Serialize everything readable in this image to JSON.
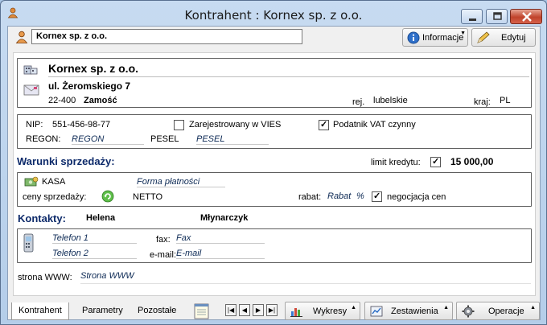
{
  "window": {
    "title": "Kontrahent : Kornex sp. z o.o."
  },
  "toolbar": {
    "name_value": "Kornex sp. z o.o.",
    "info_label": "Informacje",
    "edit_label": "Edytuj"
  },
  "address": {
    "company": "Kornex sp. z o.o.",
    "street": "ul. Żeromskiego 7",
    "postcode": "22-400",
    "city": "Zamość",
    "region_label": "rej.",
    "region": "lubelskie",
    "country_label": "kraj:",
    "country": "PL"
  },
  "ids": {
    "nip_label": "NIP:",
    "nip": "551-456-98-77",
    "vies_label": "Zarejestrowany w VIES",
    "vies_checked": false,
    "vat_label": "Podatnik VAT czynny",
    "vat_checked": true,
    "regon_label": "REGON:",
    "regon_placeholder": "REGON",
    "pesel_label": "PESEL",
    "pesel_placeholder": "PESEL"
  },
  "sales": {
    "title": "Warunki sprzedaży:",
    "credit_label": "limit kredytu:",
    "credit_checked": true,
    "credit_value": "15 000,00",
    "payment_method": "KASA",
    "payment_form_placeholder": "Forma płatności",
    "price_label": "ceny sprzedaży:",
    "price_value": "NETTO",
    "discount_label": "rabat:",
    "discount_placeholder": "Rabat",
    "discount_unit": "%",
    "negotiation_label": "negocjacja cen",
    "negotiation_checked": true
  },
  "contacts": {
    "title": "Kontakty:",
    "first_name": "Helena",
    "last_name": "Młynarczyk",
    "phone1_placeholder": "Telefon 1",
    "phone2_placeholder": "Telefon 2",
    "fax_label": "fax:",
    "fax_placeholder": "Fax",
    "email_label": "e-mail:",
    "email_placeholder": "E-mail",
    "www_label": "strona WWW:",
    "www_placeholder": "Strona WWW"
  },
  "tabs": [
    "Kontrahent",
    "Parametry",
    "Pozostałe"
  ],
  "bottom": {
    "charts_label": "Wykresy",
    "reports_label": "Zestawienia",
    "operations_label": "Operacje"
  }
}
